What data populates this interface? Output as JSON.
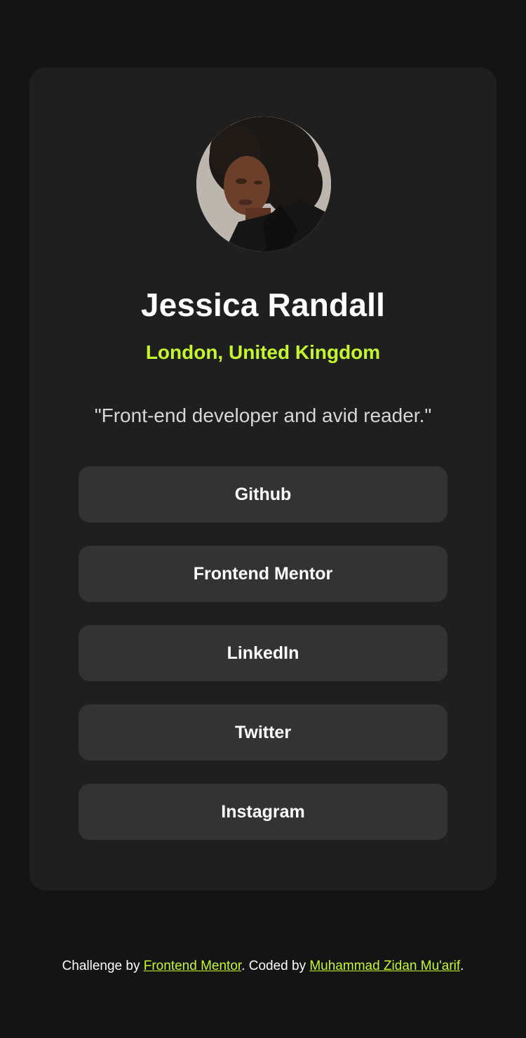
{
  "profile": {
    "name": "Jessica Randall",
    "location": "London, United Kingdom",
    "bio": "\"Front-end developer and avid reader.\""
  },
  "links": [
    {
      "label": "Github"
    },
    {
      "label": "Frontend Mentor"
    },
    {
      "label": "LinkedIn"
    },
    {
      "label": "Twitter"
    },
    {
      "label": "Instagram"
    }
  ],
  "footer": {
    "prefix": "Challenge by ",
    "challenge_link": "Frontend Mentor",
    "middle": ". Coded by ",
    "author_link": "Muhammad Zidan Mu'arif",
    "suffix": "."
  },
  "colors": {
    "page_background": "#141414",
    "card_background": "#1f1f1f",
    "button_background": "#333333",
    "accent": "#c4f82a",
    "text": "#ffffff"
  }
}
